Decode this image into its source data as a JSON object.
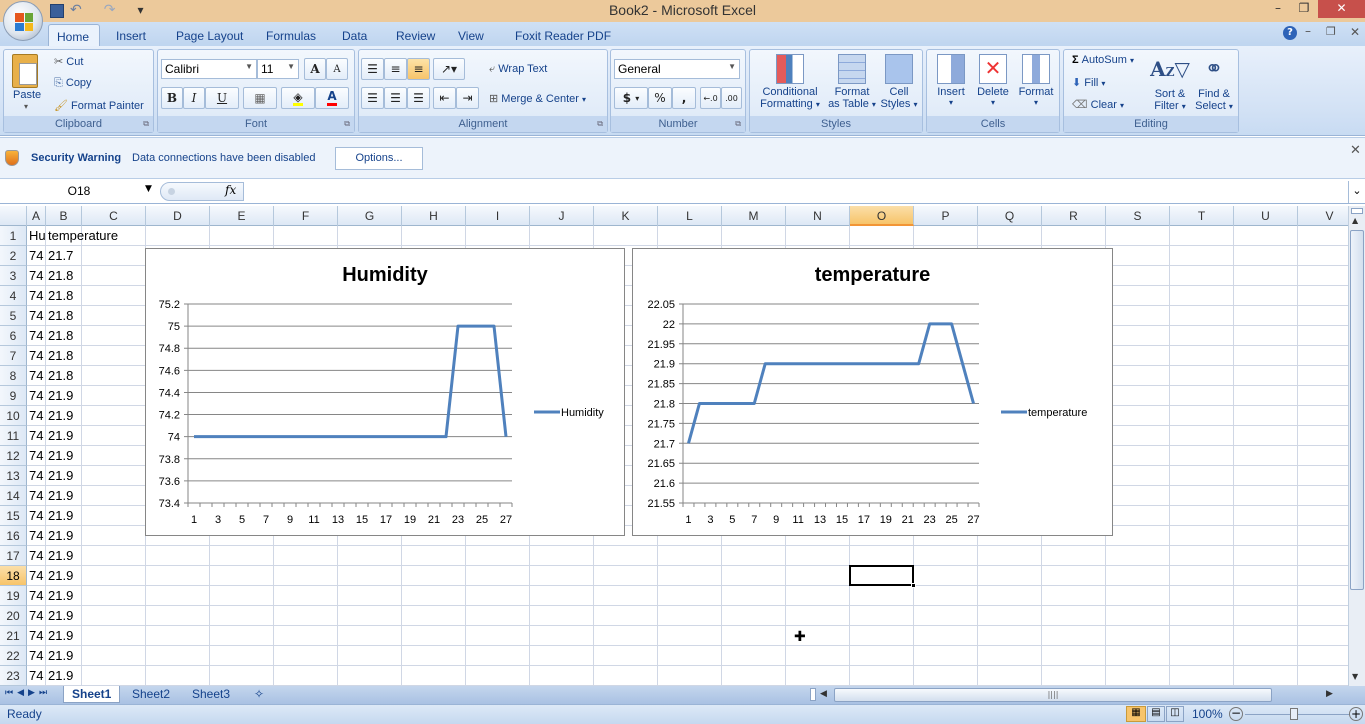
{
  "window": {
    "title": "Book2 - Microsoft Excel",
    "minimize": "–",
    "maximize": "❐",
    "close": "✕"
  },
  "qat": {
    "save": "save",
    "undo": "↶",
    "redo": "↷",
    "customize": "▾"
  },
  "tabs": [
    "Home",
    "Insert",
    "Page Layout",
    "Formulas",
    "Data",
    "Review",
    "View",
    "Foxit Reader PDF"
  ],
  "active_tab": "Home",
  "ribbon": {
    "clipboard": {
      "label": "Clipboard",
      "paste": "Paste",
      "cut": "Cut",
      "copy": "Copy",
      "format_painter": "Format Painter"
    },
    "font": {
      "label": "Font",
      "font_name": "Calibri",
      "font_size": "11",
      "bold": "B",
      "italic": "I",
      "underline": "U",
      "grow": "A",
      "shrink": "A",
      "font_color": "A"
    },
    "alignment": {
      "label": "Alignment",
      "wrap_text": "Wrap Text",
      "merge_center": "Merge & Center"
    },
    "number": {
      "label": "Number",
      "format": "General",
      "currency": "$",
      "percent": "%",
      "comma": ",",
      "inc_decimal": "←.0",
      "dec_decimal": ".00"
    },
    "styles": {
      "label": "Styles",
      "conditional_1": "Conditional",
      "conditional_2": "Formatting",
      "format_table_1": "Format",
      "format_table_2": "as Table",
      "cell_styles_1": "Cell",
      "cell_styles_2": "Styles"
    },
    "cells": {
      "label": "Cells",
      "insert": "Insert",
      "delete": "Delete",
      "format": "Format"
    },
    "editing": {
      "label": "Editing",
      "autosum": "AutoSum",
      "fill": "Fill",
      "clear": "Clear",
      "sort_1": "Sort &",
      "sort_2": "Filter",
      "find_1": "Find &",
      "find_2": "Select"
    }
  },
  "security": {
    "title": "Security Warning",
    "message": "Data connections have been disabled",
    "options": "Options..."
  },
  "formula_bar": {
    "name_box": "O18",
    "fx": "fx",
    "formula": ""
  },
  "columns": [
    "A",
    "B",
    "C",
    "D",
    "E",
    "F",
    "G",
    "H",
    "I",
    "J",
    "K",
    "L",
    "M",
    "N",
    "O",
    "P",
    "Q",
    "R",
    "S",
    "T",
    "U",
    "V"
  ],
  "selected_column": "O",
  "rows": [
    "1",
    "2",
    "3",
    "4",
    "5",
    "6",
    "7",
    "8",
    "9",
    "10",
    "11",
    "12",
    "13",
    "14",
    "15",
    "16",
    "17",
    "18",
    "19",
    "20",
    "21",
    "22",
    "23"
  ],
  "selected_row": "18",
  "cells": {
    "A1": "Hu",
    "B1": "temperature",
    "colA": [
      "74",
      "74",
      "74",
      "74",
      "74",
      "74",
      "74",
      "74",
      "74",
      "74",
      "74",
      "74",
      "74",
      "74",
      "74",
      "74",
      "74",
      "74",
      "74",
      "74",
      "74",
      "74"
    ],
    "colB": [
      "21.7",
      "21.8",
      "21.8",
      "21.8",
      "21.8",
      "21.8",
      "21.8",
      "21.9",
      "21.9",
      "21.9",
      "21.9",
      "21.9",
      "21.9",
      "21.9",
      "21.9",
      "21.9",
      "21.9",
      "21.9",
      "21.9",
      "21.9",
      "21.9",
      "21.9"
    ]
  },
  "sheets": [
    "Sheet1",
    "Sheet2",
    "Sheet3"
  ],
  "active_sheet": "Sheet1",
  "status": {
    "ready": "Ready",
    "zoom": "100%"
  },
  "colors": {
    "series": "#4f81bd",
    "accent": "#f7c46a"
  },
  "chart_data": [
    {
      "type": "line",
      "title": "Humidity",
      "xlabel": "",
      "ylabel": "",
      "x": [
        1,
        2,
        3,
        4,
        5,
        6,
        7,
        8,
        9,
        10,
        11,
        12,
        13,
        14,
        15,
        16,
        17,
        18,
        19,
        20,
        21,
        22,
        23,
        24,
        25,
        26,
        27
      ],
      "x_tick_labels": [
        "1",
        "3",
        "5",
        "7",
        "9",
        "11",
        "13",
        "15",
        "17",
        "19",
        "21",
        "23",
        "25",
        "27"
      ],
      "series": [
        {
          "name": "Humidity",
          "values": [
            74,
            74,
            74,
            74,
            74,
            74,
            74,
            74,
            74,
            74,
            74,
            74,
            74,
            74,
            74,
            74,
            74,
            74,
            74,
            74,
            74,
            74,
            75,
            75,
            75,
            75,
            74
          ]
        }
      ],
      "ylim": [
        73.4,
        75.2
      ],
      "y_ticks": [
        "73.4",
        "73.6",
        "73.8",
        "74",
        "74.2",
        "74.4",
        "74.6",
        "74.8",
        "75",
        "75.2"
      ],
      "grid": true,
      "legend": "right"
    },
    {
      "type": "line",
      "title": "temperature",
      "xlabel": "",
      "ylabel": "",
      "x": [
        1,
        2,
        3,
        4,
        5,
        6,
        7,
        8,
        9,
        10,
        11,
        12,
        13,
        14,
        15,
        16,
        17,
        18,
        19,
        20,
        21,
        22,
        23,
        24,
        25,
        26,
        27
      ],
      "x_tick_labels": [
        "1",
        "3",
        "5",
        "7",
        "9",
        "11",
        "13",
        "15",
        "17",
        "19",
        "21",
        "23",
        "25",
        "27"
      ],
      "series": [
        {
          "name": "temperature",
          "values": [
            21.7,
            21.8,
            21.8,
            21.8,
            21.8,
            21.8,
            21.8,
            21.9,
            21.9,
            21.9,
            21.9,
            21.9,
            21.9,
            21.9,
            21.9,
            21.9,
            21.9,
            21.9,
            21.9,
            21.9,
            21.9,
            21.9,
            22,
            22,
            22,
            21.9,
            21.8
          ]
        }
      ],
      "ylim": [
        21.55,
        22.05
      ],
      "y_ticks": [
        "21.55",
        "21.6",
        "21.65",
        "21.7",
        "21.75",
        "21.8",
        "21.85",
        "21.9",
        "21.95",
        "22",
        "22.05"
      ],
      "grid": true,
      "legend": "right"
    }
  ]
}
